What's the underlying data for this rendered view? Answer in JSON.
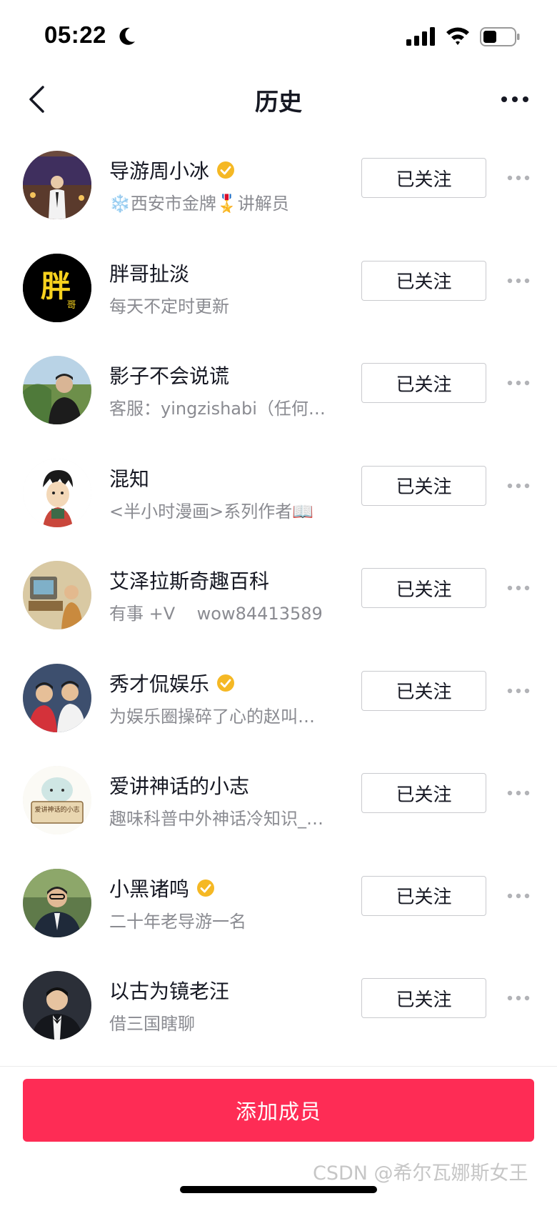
{
  "status_bar": {
    "time": "05:22"
  },
  "nav": {
    "title": "历史"
  },
  "users": [
    {
      "name": "导游周小冰",
      "verified": true,
      "desc": "❄️西安市金牌🎖️讲解员",
      "follow_label": "已关注"
    },
    {
      "name": "胖哥扯淡",
      "verified": false,
      "desc": "每天不定时更新",
      "follow_label": "已关注",
      "avatar_text": "胖",
      "avatar_subtext": "哥"
    },
    {
      "name": "影子不会说谎",
      "verified": false,
      "desc": "客服：yingzishabi（任何…",
      "follow_label": "已关注"
    },
    {
      "name": "混知",
      "verified": false,
      "desc": "<半小时漫画>系列作者📖",
      "follow_label": "已关注"
    },
    {
      "name": "艾泽拉斯奇趣百科",
      "verified": false,
      "desc": "有事 +V    wow84413589",
      "follow_label": "已关注"
    },
    {
      "name": "秀才侃娱乐",
      "verified": true,
      "desc": "为娱乐圈操碎了心的赵叫…",
      "follow_label": "已关注"
    },
    {
      "name": "爱讲神话的小志",
      "verified": false,
      "desc": "趣味科普中外神话冷知识_…",
      "follow_label": "已关注",
      "avatar_text": "爱讲神话的小志"
    },
    {
      "name": "小黑诸鸣",
      "verified": true,
      "desc": "二十年老导游一名",
      "follow_label": "已关注"
    },
    {
      "name": "以古为镜老汪",
      "verified": false,
      "desc": "借三国瞎聊",
      "follow_label": "已关注"
    }
  ],
  "bottom": {
    "add_label": "添加成员",
    "watermark": "CSDN @希尔瓦娜斯女王"
  },
  "colors": {
    "accent": "#fe2c55",
    "verified": "#f5b824",
    "secondary_text": "#8a8b91"
  }
}
